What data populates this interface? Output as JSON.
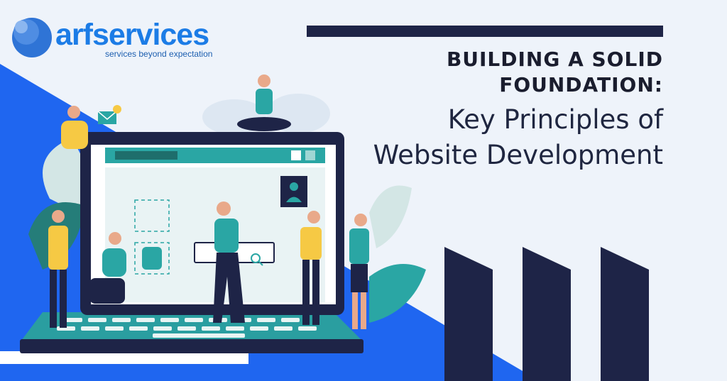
{
  "brand": {
    "name": "arfservices",
    "tagline": "services beyond expectation",
    "logo_icon": "globe-dots-icon"
  },
  "heading": {
    "line1": "BUILDING A SOLID",
    "line2": "FOUNDATION:",
    "line3": "Key Principles of",
    "line4": "Website Development"
  },
  "colors": {
    "background": "#eef3fa",
    "accent_blue": "#1f66f0",
    "navy": "#1e2447",
    "teal": "#2aa6a4",
    "brand_blue": "#1c7ce6"
  },
  "illustration": {
    "subject": "laptop-with-team-icon",
    "notification_count": "1"
  }
}
